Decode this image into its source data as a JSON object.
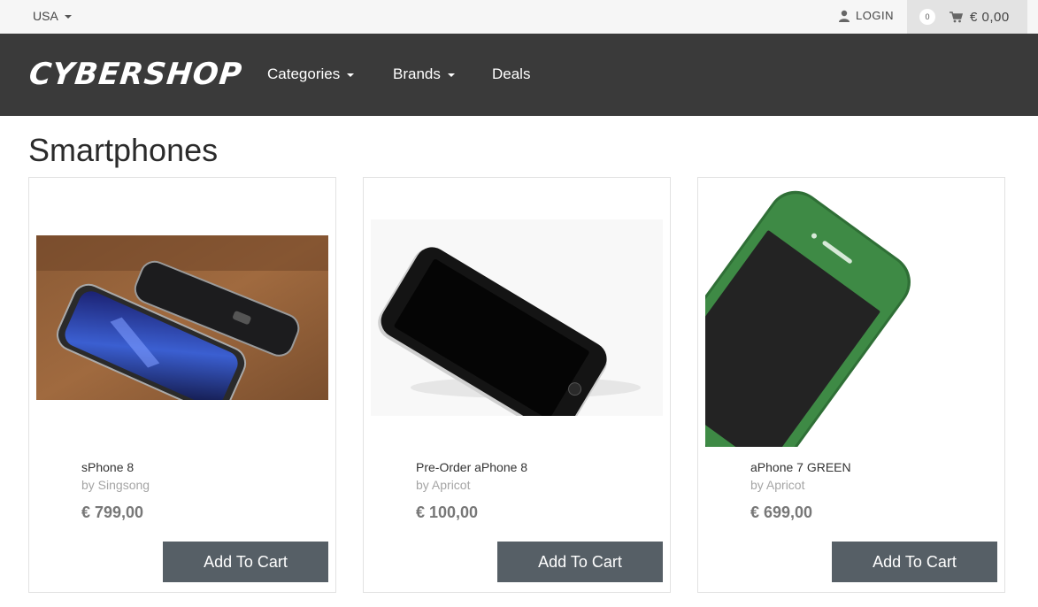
{
  "topbar": {
    "country": "USA",
    "login_label": "LOGIN",
    "cart_count": "0",
    "cart_total": "€ 0,00"
  },
  "nav": {
    "logo": "CYBERSHOP",
    "items": [
      {
        "label": "Categories",
        "dropdown": true
      },
      {
        "label": "Brands",
        "dropdown": true
      },
      {
        "label": "Deals",
        "dropdown": false
      }
    ]
  },
  "page": {
    "title": "Smartphones"
  },
  "products": [
    {
      "name": "sPhone 8",
      "brand": "by Singsong",
      "price": "€ 799,00",
      "button": "Add To Cart"
    },
    {
      "name": "Pre-Order aPhone 8",
      "brand": "by Apricot",
      "price": "€ 100,00",
      "button": "Add To Cart"
    },
    {
      "name": "aPhone 7 GREEN",
      "brand": "by Apricot",
      "price": "€ 699,00",
      "button": "Add To Cart"
    }
  ],
  "colors": {
    "topbar_bg": "#f6f6f6",
    "nav_bg": "#3a3a3a",
    "button_bg": "#565f66",
    "cart_bg": "#e3e3e3",
    "phone_green": "#3e8a45"
  },
  "icons": [
    "caret-down-icon",
    "user-icon",
    "shopping-cart-icon"
  ]
}
